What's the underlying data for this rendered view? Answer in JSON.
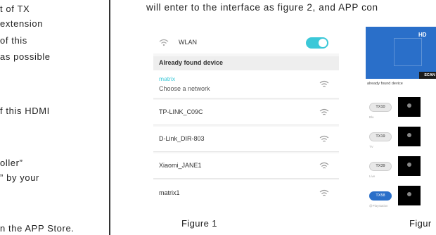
{
  "left_column": {
    "lines": [
      "t of TX",
      "extension",
      "of this",
      "as possible",
      "f this HDMI",
      "oller”",
      "”  by your",
      "n the APP Store."
    ]
  },
  "top_text": "will enter to the interface as figure 2, and APP con",
  "figure1": {
    "wlan_label": "WLAN",
    "toggle_on": true,
    "found_header": "Already found device",
    "networks": [
      {
        "name": "matrix",
        "sub": "Choose a network"
      },
      {
        "name": "TP-LINK_C09C"
      },
      {
        "name": "D-Link_DIR-803"
      },
      {
        "name": "Xiaomi_JANE1"
      },
      {
        "name": "matrix1"
      }
    ],
    "caption": "Figure 1"
  },
  "figure2": {
    "title": "HD",
    "scan_label": "SCAN",
    "already_label": "already found device",
    "devices": [
      {
        "label": "TX10",
        "sub": "Blu",
        "active": false
      },
      {
        "label": "TX19",
        "sub": "TV",
        "active": false
      },
      {
        "label": "TX39",
        "sub": "Live",
        "active": false
      },
      {
        "label": "TX58",
        "sub": "@Playstation",
        "active": true
      }
    ],
    "caption": "Figur"
  },
  "colors": {
    "accent": "#3bc8d8",
    "app_blue": "#2a6fc9",
    "text": "#222222"
  }
}
